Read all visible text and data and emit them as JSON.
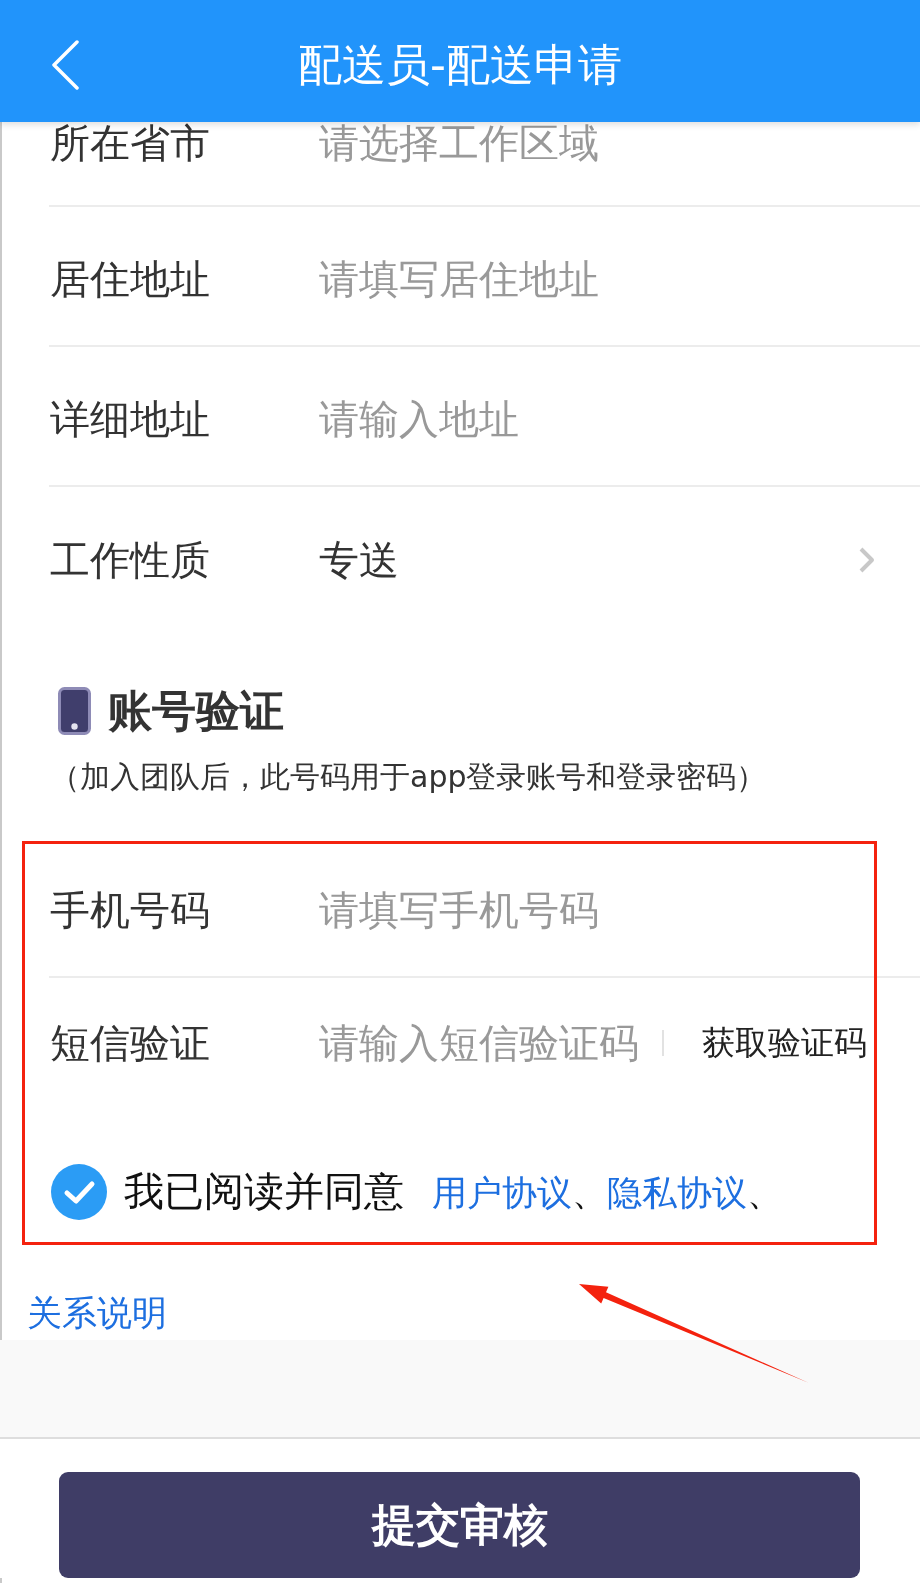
{
  "header": {
    "title": "配送员-配送申请"
  },
  "address_rows": [
    {
      "kind": "input",
      "label": "所在省市",
      "placeholder": "请选择工作区域"
    },
    {
      "kind": "input",
      "label": "居住地址",
      "placeholder": "请填写居住地址"
    },
    {
      "kind": "input",
      "label": "详细地址",
      "placeholder": "请输入地址"
    },
    {
      "kind": "select",
      "label": "工作性质",
      "value": "专送"
    }
  ],
  "account_section": {
    "title": "账号验证",
    "note": "（加入团队后，此号码用于app登录账号和登录密码）",
    "rows": [
      {
        "kind": "input",
        "label": "手机号码",
        "placeholder": "请填写手机号码"
      },
      {
        "kind": "code",
        "label": "短信验证",
        "placeholder": "请输入短信验证码",
        "action": "获取验证码"
      }
    ]
  },
  "agreement": {
    "checked": true,
    "text": "我已阅读并同意",
    "links": [
      {
        "text": "用户协议",
        "separator": "、"
      },
      {
        "text": "隐私协议",
        "separator": "、"
      }
    ]
  },
  "relation_link": "关系说明",
  "submit_button": "提交审核"
}
